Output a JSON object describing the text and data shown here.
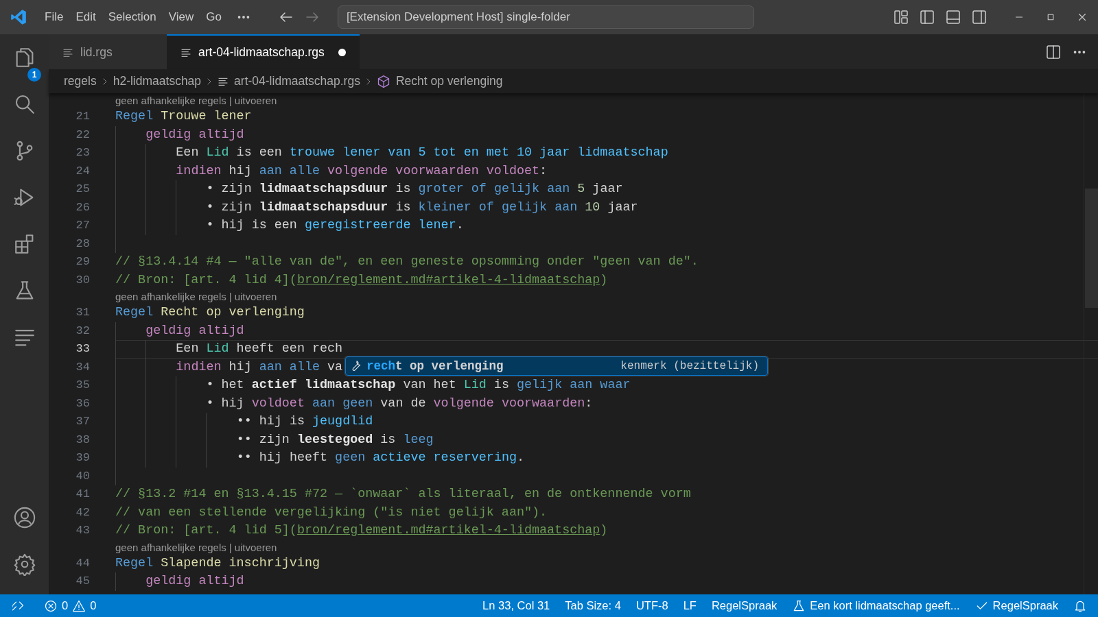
{
  "title_bar": {
    "menu": [
      "File",
      "Edit",
      "Selection",
      "View",
      "Go"
    ],
    "back_enabled": true,
    "forward_enabled": false,
    "command_center": "[Extension Development Host] single-folder"
  },
  "activity_bar": {
    "top": [
      {
        "kind": "explorer",
        "badge": "1"
      },
      {
        "kind": "search"
      },
      {
        "kind": "scm"
      },
      {
        "kind": "debug"
      },
      {
        "kind": "extensions"
      },
      {
        "kind": "testing"
      },
      {
        "kind": "outline"
      }
    ],
    "bottom": [
      {
        "kind": "account"
      },
      {
        "kind": "settings"
      }
    ]
  },
  "tabs": [
    {
      "label": "lid.rgs",
      "selected": false,
      "dirty": false
    },
    {
      "label": "art-04-lidmaatschap.rgs",
      "selected": true,
      "dirty": true
    }
  ],
  "breadcrumbs": [
    {
      "label": "regels",
      "kind": "folder"
    },
    {
      "label": "h2-lidmaatschap",
      "kind": "folder"
    },
    {
      "label": "art-04-lidmaatschap.rgs",
      "kind": "file"
    },
    {
      "label": "Recht op verlenging",
      "kind": "symbol"
    }
  ],
  "editor": {
    "lines": [
      {
        "kind": "lens",
        "links": [
          "geen afhankelijke regels",
          "uitvoeren"
        ],
        "separator": "|"
      },
      {
        "kind": "code",
        "number": "21",
        "current": false,
        "tokens": [
          {
            "kind": "kw",
            "text": "Regel "
          },
          {
            "kind": "name",
            "text": "Trouwe lener"
          }
        ],
        "children": [
          {
            "kind": "code",
            "number": "22",
            "current": false,
            "tokens": [
              {
                "kind": "ctrl",
                "text": "geldig altijd"
              }
            ],
            "children": [
              {
                "kind": "code",
                "number": "23",
                "current": false,
                "tokens": [
                  {
                    "kind": "plain",
                    "text": "Een "
                  },
                  {
                    "kind": "type",
                    "text": "Lid"
                  },
                  {
                    "kind": "plain",
                    "text": " is een "
                  },
                  {
                    "kind": "ref",
                    "text": "trouwe lener van 5 tot en met 10 jaar lidmaatschap"
                  }
                ]
              },
              {
                "kind": "code",
                "number": "24",
                "current": false,
                "tokens": [
                  {
                    "kind": "ctrl",
                    "text": "indien"
                  },
                  {
                    "kind": "plain",
                    "text": " hij "
                  },
                  {
                    "kind": "kw",
                    "text": "aan alle "
                  },
                  {
                    "kind": "ctrl",
                    "text": "volgende voorwaarden voldoet"
                  },
                  {
                    "kind": "plain",
                    "text": ":"
                  }
                ],
                "children": [
                  {
                    "kind": "code",
                    "number": "25",
                    "current": false,
                    "tokens": [
                      {
                        "kind": "plain",
                        "text": "• zijn "
                      },
                      {
                        "kind": "prop",
                        "text": "lidmaatschapsduur"
                      },
                      {
                        "kind": "plain",
                        "text": " is "
                      },
                      {
                        "kind": "kw",
                        "text": "groter of gelijk aan "
                      },
                      {
                        "kind": "num",
                        "text": "5"
                      },
                      {
                        "kind": "plain",
                        "text": " jaar"
                      }
                    ]
                  },
                  {
                    "kind": "code",
                    "number": "26",
                    "current": false,
                    "tokens": [
                      {
                        "kind": "plain",
                        "text": "• zijn "
                      },
                      {
                        "kind": "prop",
                        "text": "lidmaatschapsduur"
                      },
                      {
                        "kind": "plain",
                        "text": " is "
                      },
                      {
                        "kind": "kw",
                        "text": "kleiner of gelijk aan "
                      },
                      {
                        "kind": "num",
                        "text": "10"
                      },
                      {
                        "kind": "plain",
                        "text": " jaar"
                      }
                    ]
                  },
                  {
                    "kind": "code",
                    "number": "27",
                    "current": false,
                    "tokens": [
                      {
                        "kind": "plain",
                        "text": "• hij is een "
                      },
                      {
                        "kind": "ref",
                        "text": "geregistreerde lener"
                      },
                      {
                        "kind": "plain",
                        "text": "."
                      }
                    ]
                  }
                ]
              }
            ]
          },
          {
            "kind": "code",
            "number": "28",
            "current": false
          }
        ]
      },
      {
        "kind": "code",
        "number": "29",
        "current": false,
        "tokens": [
          {
            "kind": "comment",
            "text": "// §13.4.14 #4 — \"alle van de\", en een geneste opsomming onder \"geen van de\"."
          }
        ]
      },
      {
        "kind": "code",
        "number": "30",
        "current": false,
        "tokens": [
          {
            "kind": "comment",
            "text": "// Bron: [art. 4 lid 4]("
          },
          {
            "kind": "link",
            "text": "bron/reglement.md#artikel-4-lidmaatschap"
          },
          {
            "kind": "comment",
            "text": ")"
          }
        ]
      },
      {
        "kind": "lens",
        "links": [
          "geen afhankelijke regels",
          "uitvoeren"
        ],
        "separator": "|"
      },
      {
        "kind": "code",
        "number": "31",
        "current": false,
        "tokens": [
          {
            "kind": "kw",
            "text": "Regel "
          },
          {
            "kind": "name",
            "text": "Recht op verlenging"
          }
        ],
        "children": [
          {
            "kind": "code",
            "number": "32",
            "current": false,
            "tokens": [
              {
                "kind": "ctrl",
                "text": "geldig altijd"
              }
            ],
            "children": [
              {
                "kind": "code",
                "number": "33",
                "current": true,
                "tokens": [
                  {
                    "kind": "plain",
                    "text": "Een "
                  },
                  {
                    "kind": "type",
                    "text": "Lid"
                  },
                  {
                    "kind": "plain",
                    "text": " heeft een rech"
                  }
                ]
              },
              {
                "kind": "code",
                "number": "34",
                "current": false,
                "tokens": [
                  {
                    "kind": "ctrl",
                    "text": "indien"
                  },
                  {
                    "kind": "plain",
                    "text": " hij "
                  },
                  {
                    "kind": "kw",
                    "text": "aan alle"
                  },
                  {
                    "kind": "plain",
                    "text": " va"
                  }
                ],
                "children": [
                  {
                    "kind": "code",
                    "number": "35",
                    "current": false,
                    "tokens": [
                      {
                        "kind": "plain",
                        "text": "• het "
                      },
                      {
                        "kind": "prop",
                        "text": "actief lidmaatschap"
                      },
                      {
                        "kind": "plain",
                        "text": " van het "
                      },
                      {
                        "kind": "type",
                        "text": "Lid"
                      },
                      {
                        "kind": "plain",
                        "text": " is "
                      },
                      {
                        "kind": "kw",
                        "text": "gelijk aan waar"
                      }
                    ]
                  },
                  {
                    "kind": "code",
                    "number": "36",
                    "current": false,
                    "tokens": [
                      {
                        "kind": "plain",
                        "text": "• hij "
                      },
                      {
                        "kind": "ctrl",
                        "text": "voldoet "
                      },
                      {
                        "kind": "kw",
                        "text": "aan geen"
                      },
                      {
                        "kind": "plain",
                        "text": " van de "
                      },
                      {
                        "kind": "ctrl",
                        "text": "volgende voorwaarden"
                      },
                      {
                        "kind": "plain",
                        "text": ":"
                      }
                    ],
                    "children": [
                      {
                        "kind": "code",
                        "number": "37",
                        "current": false,
                        "tokens": [
                          {
                            "kind": "plain",
                            "text": "•• hij is "
                          },
                          {
                            "kind": "ref",
                            "text": "jeugdlid"
                          }
                        ]
                      },
                      {
                        "kind": "code",
                        "number": "38",
                        "current": false,
                        "tokens": [
                          {
                            "kind": "plain",
                            "text": "•• zijn "
                          },
                          {
                            "kind": "prop",
                            "text": "leestegoed"
                          },
                          {
                            "kind": "plain",
                            "text": " is "
                          },
                          {
                            "kind": "kw",
                            "text": "leeg"
                          }
                        ]
                      },
                      {
                        "kind": "code",
                        "number": "39",
                        "current": false,
                        "tokens": [
                          {
                            "kind": "plain",
                            "text": "•• hij heeft "
                          },
                          {
                            "kind": "kw",
                            "text": "geen "
                          },
                          {
                            "kind": "ref",
                            "text": "actieve reservering"
                          },
                          {
                            "kind": "plain",
                            "text": "."
                          }
                        ]
                      }
                    ]
                  }
                ]
              }
            ]
          },
          {
            "kind": "code",
            "number": "40",
            "current": false
          }
        ]
      },
      {
        "kind": "code",
        "number": "41",
        "current": false,
        "tokens": [
          {
            "kind": "comment",
            "text": "// §13.2 #14 en §13.4.15 #72 — `onwaar` als literaal, en de ontkennende vorm"
          }
        ]
      },
      {
        "kind": "code",
        "number": "42",
        "current": false,
        "tokens": [
          {
            "kind": "comment",
            "text": "// van een stellende vergelijking (\"is niet gelijk aan\")."
          }
        ]
      },
      {
        "kind": "code",
        "number": "43",
        "current": false,
        "tokens": [
          {
            "kind": "comment",
            "text": "// Bron: [art. 4 lid 5]("
          },
          {
            "kind": "link",
            "text": "bron/reglement.md#artikel-4-lidmaatschap"
          },
          {
            "kind": "comment",
            "text": ")"
          }
        ]
      },
      {
        "kind": "lens",
        "links": [
          "geen afhankelijke regels",
          "uitvoeren"
        ],
        "separator": "|"
      },
      {
        "kind": "code",
        "number": "44",
        "current": false,
        "tokens": [
          {
            "kind": "kw",
            "text": "Regel "
          },
          {
            "kind": "name",
            "text": "Slapende inschrijving"
          }
        ],
        "children": [
          {
            "kind": "code",
            "number": "45",
            "current": false,
            "tokens": [
              {
                "kind": "ctrl",
                "text": "geldig altijd"
              }
            ]
          }
        ]
      }
    ],
    "suggest": {
      "selected": true,
      "matched": "rech",
      "rest": "t op verlenging",
      "detail": "kenmerk (bezittelijk)"
    }
  },
  "status_bar": {
    "left": [
      {
        "kind": "errors",
        "label": "0"
      },
      {
        "kind": "warnings",
        "label": "0"
      }
    ],
    "right": [
      {
        "kind": "text",
        "label": "Ln 33, Col 31"
      },
      {
        "kind": "text",
        "label": "Tab Size: 4"
      },
      {
        "kind": "text",
        "label": "UTF-8"
      },
      {
        "kind": "text",
        "label": "LF"
      },
      {
        "kind": "text",
        "label": "RegelSpraak"
      },
      {
        "kind": "test",
        "label": "Een kort lidmaatschap geeft..."
      },
      {
        "kind": "check",
        "label": "RegelSpraak"
      },
      {
        "kind": "bell"
      }
    ]
  }
}
